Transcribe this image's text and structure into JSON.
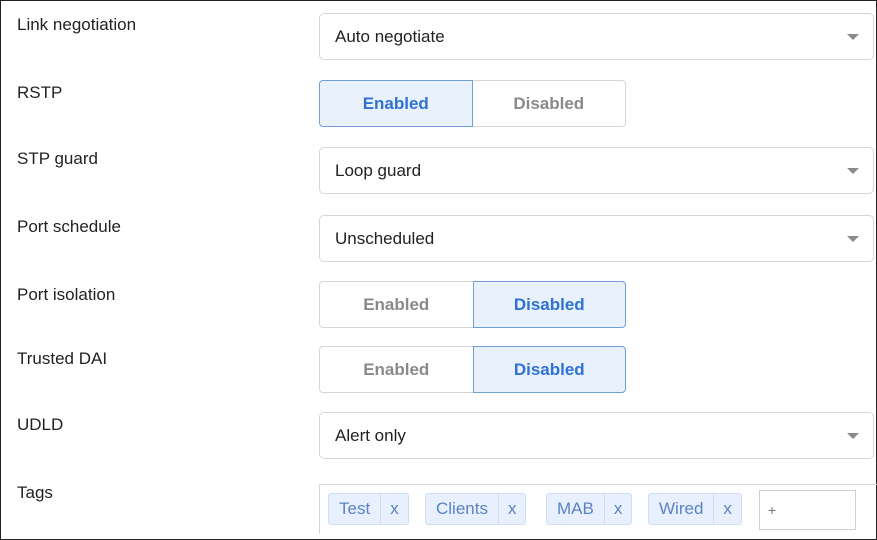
{
  "fields": {
    "link_negotiation": {
      "label": "Link negotiation",
      "value": "Auto negotiate",
      "icon": "chevron-down-icon"
    },
    "rstp": {
      "label": "RSTP",
      "options": [
        "Enabled",
        "Disabled"
      ],
      "selected": "Enabled"
    },
    "stp_guard": {
      "label": "STP guard",
      "value": "Loop guard",
      "icon": "chevron-down-icon"
    },
    "port_schedule": {
      "label": "Port schedule",
      "value": "Unscheduled",
      "icon": "chevron-down-icon"
    },
    "port_isolation": {
      "label": "Port isolation",
      "options": [
        "Enabled",
        "Disabled"
      ],
      "selected": "Disabled"
    },
    "trusted_dai": {
      "label": "Trusted DAI",
      "options": [
        "Enabled",
        "Disabled"
      ],
      "selected": "Disabled"
    },
    "udld": {
      "label": "UDLD",
      "value": "Alert only",
      "icon": "chevron-down-icon"
    },
    "tags": {
      "label": "Tags",
      "items": [
        "Test",
        "Clients",
        "MAB",
        "Wired"
      ],
      "remove_label": "x",
      "input_placeholder": "+"
    }
  },
  "colors": {
    "active_bg": "#e8f1fc",
    "active_text": "#2f72d4",
    "inactive_text": "#8a8a8a",
    "tag_bg": "#e9f0fd",
    "tag_text": "#5b82c4"
  }
}
